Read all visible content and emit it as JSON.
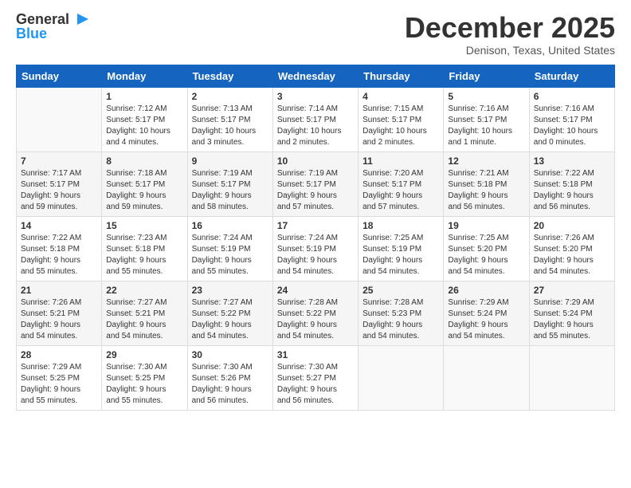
{
  "header": {
    "logo_line1": "General",
    "logo_line2": "Blue",
    "month": "December 2025",
    "location": "Denison, Texas, United States"
  },
  "days_of_week": [
    "Sunday",
    "Monday",
    "Tuesday",
    "Wednesday",
    "Thursday",
    "Friday",
    "Saturday"
  ],
  "weeks": [
    [
      {
        "num": "",
        "info": ""
      },
      {
        "num": "1",
        "info": "Sunrise: 7:12 AM\nSunset: 5:17 PM\nDaylight: 10 hours\nand 4 minutes."
      },
      {
        "num": "2",
        "info": "Sunrise: 7:13 AM\nSunset: 5:17 PM\nDaylight: 10 hours\nand 3 minutes."
      },
      {
        "num": "3",
        "info": "Sunrise: 7:14 AM\nSunset: 5:17 PM\nDaylight: 10 hours\nand 2 minutes."
      },
      {
        "num": "4",
        "info": "Sunrise: 7:15 AM\nSunset: 5:17 PM\nDaylight: 10 hours\nand 2 minutes."
      },
      {
        "num": "5",
        "info": "Sunrise: 7:16 AM\nSunset: 5:17 PM\nDaylight: 10 hours\nand 1 minute."
      },
      {
        "num": "6",
        "info": "Sunrise: 7:16 AM\nSunset: 5:17 PM\nDaylight: 10 hours\nand 0 minutes."
      }
    ],
    [
      {
        "num": "7",
        "info": "Sunrise: 7:17 AM\nSunset: 5:17 PM\nDaylight: 9 hours\nand 59 minutes."
      },
      {
        "num": "8",
        "info": "Sunrise: 7:18 AM\nSunset: 5:17 PM\nDaylight: 9 hours\nand 59 minutes."
      },
      {
        "num": "9",
        "info": "Sunrise: 7:19 AM\nSunset: 5:17 PM\nDaylight: 9 hours\nand 58 minutes."
      },
      {
        "num": "10",
        "info": "Sunrise: 7:19 AM\nSunset: 5:17 PM\nDaylight: 9 hours\nand 57 minutes."
      },
      {
        "num": "11",
        "info": "Sunrise: 7:20 AM\nSunset: 5:17 PM\nDaylight: 9 hours\nand 57 minutes."
      },
      {
        "num": "12",
        "info": "Sunrise: 7:21 AM\nSunset: 5:18 PM\nDaylight: 9 hours\nand 56 minutes."
      },
      {
        "num": "13",
        "info": "Sunrise: 7:22 AM\nSunset: 5:18 PM\nDaylight: 9 hours\nand 56 minutes."
      }
    ],
    [
      {
        "num": "14",
        "info": "Sunrise: 7:22 AM\nSunset: 5:18 PM\nDaylight: 9 hours\nand 55 minutes."
      },
      {
        "num": "15",
        "info": "Sunrise: 7:23 AM\nSunset: 5:18 PM\nDaylight: 9 hours\nand 55 minutes."
      },
      {
        "num": "16",
        "info": "Sunrise: 7:24 AM\nSunset: 5:19 PM\nDaylight: 9 hours\nand 55 minutes."
      },
      {
        "num": "17",
        "info": "Sunrise: 7:24 AM\nSunset: 5:19 PM\nDaylight: 9 hours\nand 54 minutes."
      },
      {
        "num": "18",
        "info": "Sunrise: 7:25 AM\nSunset: 5:19 PM\nDaylight: 9 hours\nand 54 minutes."
      },
      {
        "num": "19",
        "info": "Sunrise: 7:25 AM\nSunset: 5:20 PM\nDaylight: 9 hours\nand 54 minutes."
      },
      {
        "num": "20",
        "info": "Sunrise: 7:26 AM\nSunset: 5:20 PM\nDaylight: 9 hours\nand 54 minutes."
      }
    ],
    [
      {
        "num": "21",
        "info": "Sunrise: 7:26 AM\nSunset: 5:21 PM\nDaylight: 9 hours\nand 54 minutes."
      },
      {
        "num": "22",
        "info": "Sunrise: 7:27 AM\nSunset: 5:21 PM\nDaylight: 9 hours\nand 54 minutes."
      },
      {
        "num": "23",
        "info": "Sunrise: 7:27 AM\nSunset: 5:22 PM\nDaylight: 9 hours\nand 54 minutes."
      },
      {
        "num": "24",
        "info": "Sunrise: 7:28 AM\nSunset: 5:22 PM\nDaylight: 9 hours\nand 54 minutes."
      },
      {
        "num": "25",
        "info": "Sunrise: 7:28 AM\nSunset: 5:23 PM\nDaylight: 9 hours\nand 54 minutes."
      },
      {
        "num": "26",
        "info": "Sunrise: 7:29 AM\nSunset: 5:24 PM\nDaylight: 9 hours\nand 54 minutes."
      },
      {
        "num": "27",
        "info": "Sunrise: 7:29 AM\nSunset: 5:24 PM\nDaylight: 9 hours\nand 55 minutes."
      }
    ],
    [
      {
        "num": "28",
        "info": "Sunrise: 7:29 AM\nSunset: 5:25 PM\nDaylight: 9 hours\nand 55 minutes."
      },
      {
        "num": "29",
        "info": "Sunrise: 7:30 AM\nSunset: 5:25 PM\nDaylight: 9 hours\nand 55 minutes."
      },
      {
        "num": "30",
        "info": "Sunrise: 7:30 AM\nSunset: 5:26 PM\nDaylight: 9 hours\nand 56 minutes."
      },
      {
        "num": "31",
        "info": "Sunrise: 7:30 AM\nSunset: 5:27 PM\nDaylight: 9 hours\nand 56 minutes."
      },
      {
        "num": "",
        "info": ""
      },
      {
        "num": "",
        "info": ""
      },
      {
        "num": "",
        "info": ""
      }
    ]
  ]
}
